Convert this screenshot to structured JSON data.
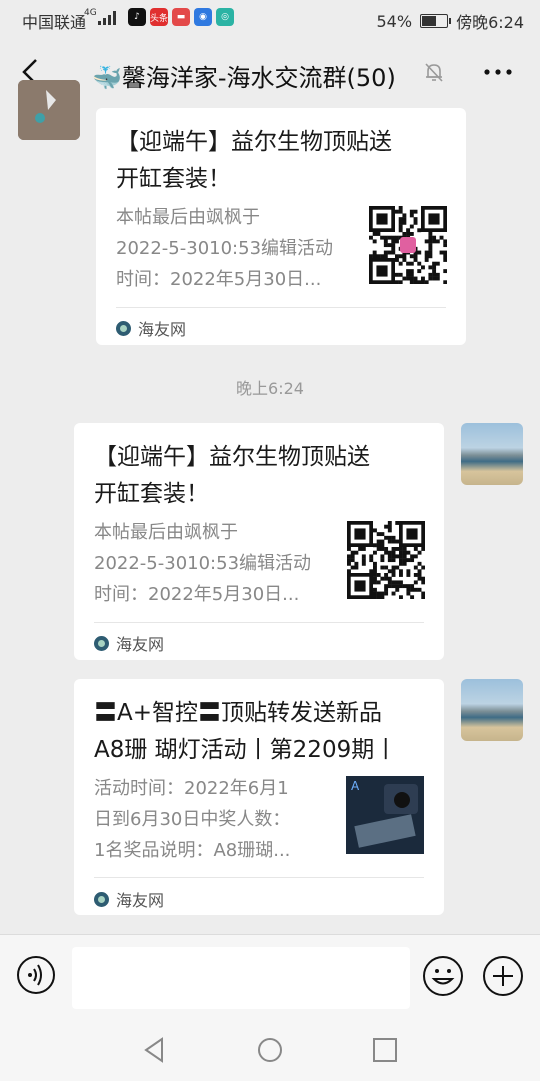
{
  "status_bar": {
    "carrier": "中国联通",
    "network": "4G",
    "app_icons": [
      {
        "name": "tiktok-icon",
        "glyph": "♪",
        "color": "#111111"
      },
      {
        "name": "toutiao-icon",
        "glyph": "头条",
        "color": "#e02f2f"
      },
      {
        "name": "app-icon",
        "glyph": "▬",
        "color": "#e34949"
      },
      {
        "name": "bulb-icon",
        "glyph": "◉",
        "color": "#2f79e0"
      },
      {
        "name": "chat-icon",
        "glyph": "◎",
        "color": "#2bb3a4"
      }
    ],
    "battery": "54%",
    "time": "傍晚6:24"
  },
  "header": {
    "title": "🐳馨海洋家-海水交流群(50)"
  },
  "messages": [
    {
      "title_lines": [
        "【迎端午】益尔生物顶贴送",
        "开缸套装！"
      ],
      "desc_lines": [
        "本帖最后由飒枫于",
        "2022-5-3010:53编辑活动",
        "时间：2022年5月30日..."
      ],
      "source": "海友网"
    },
    {
      "title_lines": [
        "【迎端午】益尔生物顶贴送",
        "开缸套装！"
      ],
      "desc_lines": [
        "本帖最后由飒枫于",
        "2022-5-3010:53编辑活动",
        "时间：2022年5月30日..."
      ],
      "source": "海友网"
    },
    {
      "title_lines": [
        "〓A+智控〓顶贴转发送新品",
        "A8珊 瑚灯活动丨第2209期丨"
      ],
      "desc_lines": [
        "活动时间：2022年6月1",
        "日到6月30日中奖人数：",
        "1名奖品说明：A8珊瑚..."
      ],
      "source": "海友网",
      "thumb_label": "A"
    }
  ],
  "timestamp": "晚上6:24",
  "input": {
    "placeholder": ""
  }
}
